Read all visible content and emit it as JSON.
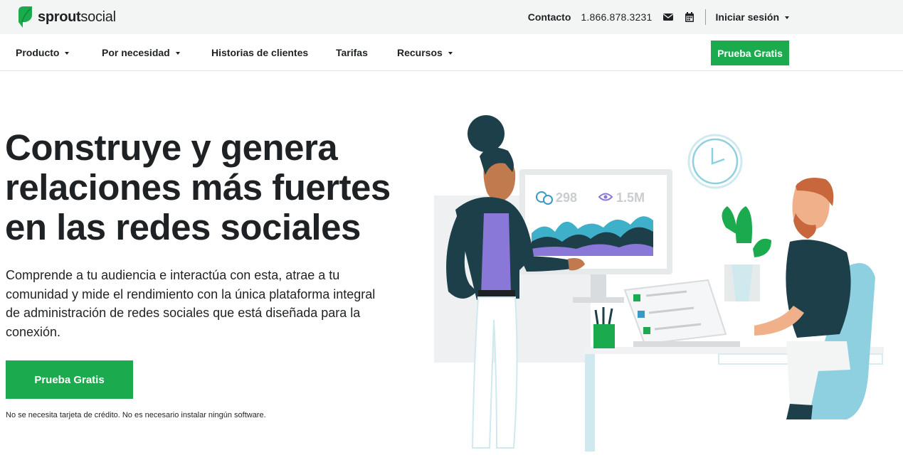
{
  "brand": {
    "name_bold": "sprout",
    "name_light": "social",
    "logo_icon": "leaf-logo-icon",
    "color": "#1bab4e"
  },
  "topbar": {
    "contact_label": "Contacto",
    "phone": "1.866.878.3231",
    "icons": [
      "envelope-icon",
      "calendar-icon"
    ],
    "login_label": "Iniciar sesión"
  },
  "nav": {
    "items": [
      {
        "label": "Producto",
        "has_dropdown": true
      },
      {
        "label": "Por necesidad",
        "has_dropdown": true
      },
      {
        "label": "Historias de clientes",
        "has_dropdown": false
      },
      {
        "label": "Tarifas",
        "has_dropdown": false
      },
      {
        "label": "Recursos",
        "has_dropdown": true
      }
    ],
    "cta_label": "Prueba Gratis"
  },
  "hero": {
    "title": "Construye y genera relaciones más fuertes en las redes sociales",
    "subtitle": "Comprende a tu audiencia e interactúa con esta, atrae a tu comunidad y mide el rendimiento con la única plataforma integral de administración de redes sociales que está diseñada para la conexión.",
    "cta_label": "Prueba Gratis",
    "note": "No se necesita tarjeta de crédito. No es necesario instalar ningún software."
  },
  "illustration": {
    "stat_comments": "298",
    "stat_views": "1.5M"
  }
}
